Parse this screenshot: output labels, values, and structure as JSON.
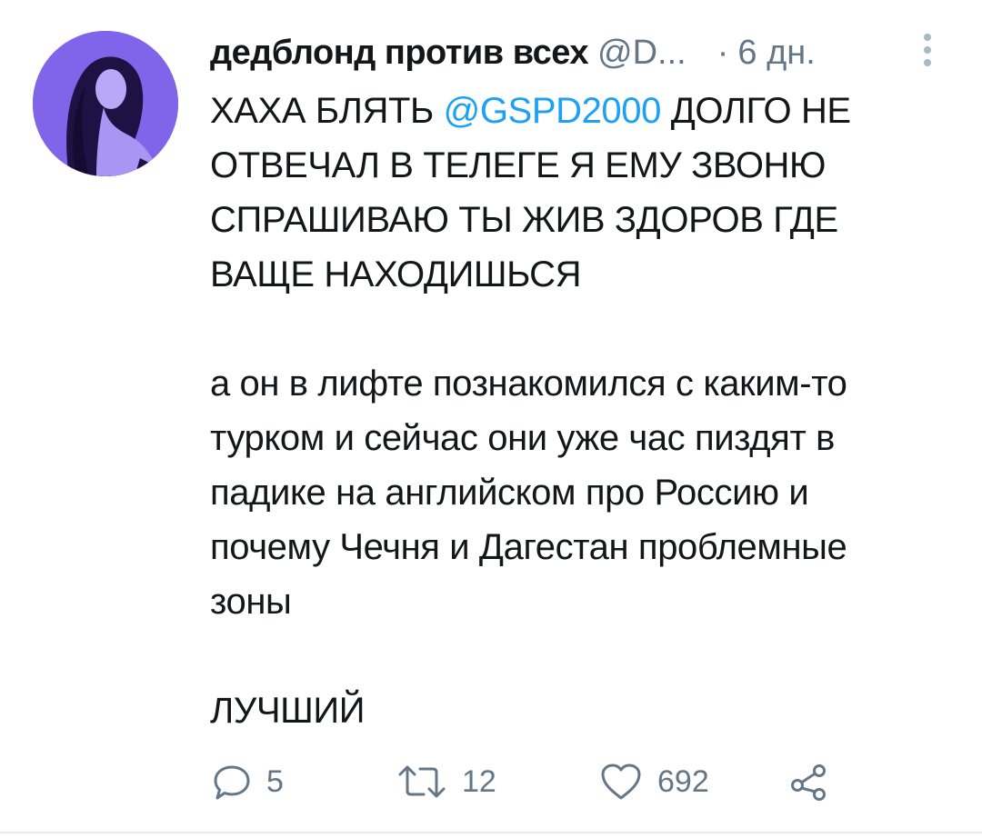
{
  "tweet": {
    "display_name": "дедблонд против всех",
    "handle": "@D...",
    "separator": "·",
    "time": "6 дн.",
    "text": {
      "line1_prefix": "ХАХА БЛЯТЬ ",
      "mention": "@GSPD2000",
      "line1_suffix": " ДОЛГО НЕ ОТВЕЧАЛ В ТЕЛЕГЕ Я ЕМУ ЗВОНЮ СПРАШИВАЮ ТЫ ЖИВ ЗДОРОВ ГДЕ ВАЩЕ НАХОДИШЬСЯ",
      "paragraph2": "а он в лифте познакомился с каким-то турком и сейчас они уже час пиздят в падике на английском про Россию и почему Чечня и Дагестан проблемные зоны",
      "paragraph3": "ЛУЧШИЙ"
    },
    "actions": {
      "replies": "5",
      "retweets": "12",
      "likes": "692"
    }
  },
  "colors": {
    "text": "#14171a",
    "secondary": "#657786",
    "link": "#1da1f2",
    "avatar_tint": "#6e52d8"
  },
  "icons": {
    "reply": "reply-icon",
    "retweet": "retweet-icon",
    "like": "heart-icon",
    "share": "share-icon",
    "more": "more-vertical-icon"
  }
}
